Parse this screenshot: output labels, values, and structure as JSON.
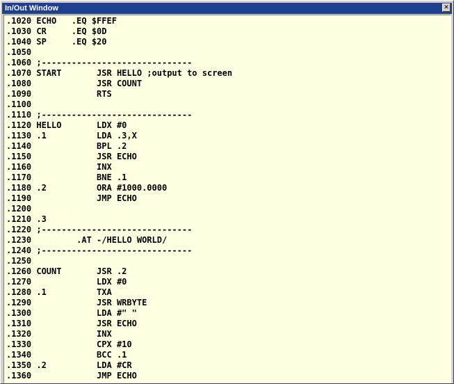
{
  "window": {
    "title": "In/Out Window",
    "close_glyph": "✕"
  },
  "lines": [
    ".1020 ECHO   .EQ $FFEF",
    ".1030 CR     .EQ $0D",
    ".1040 SP     .EQ $20",
    ".1050",
    ".1060 ;------------------------------",
    ".1070 START       JSR HELLO ;output to screen",
    ".1080             JSR COUNT",
    ".1090             RTS",
    ".1100",
    ".1110 ;------------------------------",
    ".1120 HELLO       LDX #0",
    ".1130 .1          LDA .3,X",
    ".1140             BPL .2",
    ".1150             JSR ECHO",
    ".1160             INX",
    ".1170             BNE .1",
    ".1180 .2          ORA #1000.0000",
    ".1190             JMP ECHO",
    ".1200",
    ".1210 .3",
    ".1220 ;------------------------------",
    ".1230         .AT -/HELLO WORLD/",
    ".1240 ;------------------------------",
    ".1250",
    ".1260 COUNT       JSR .2",
    ".1270             LDX #0",
    ".1280 .1          TXA",
    ".1290             JSR WRBYTE",
    ".1300             LDA #\" \"",
    ".1310             JSR ECHO",
    ".1320             INX",
    ".1330             CPX #10",
    ".1340             BCC .1",
    ".1350 .2          LDA #CR",
    ".1360             JMP ECHO"
  ]
}
